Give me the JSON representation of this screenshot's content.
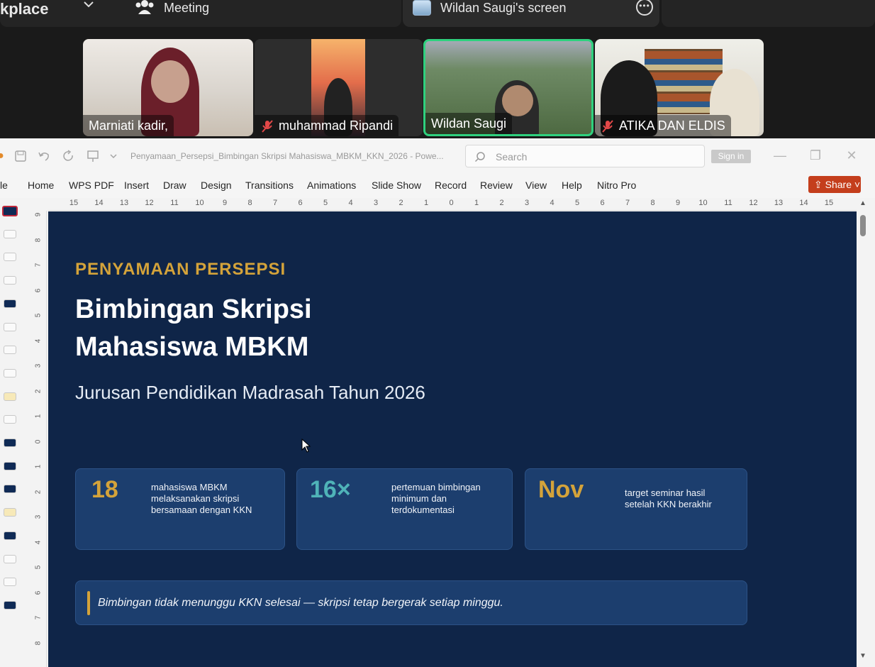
{
  "meeting": {
    "workplace_label": "kplace",
    "meeting_tab": "Meeting",
    "screen_tab": "Wildan Saugi's screen",
    "more_label": "•••"
  },
  "participants": [
    {
      "name": "Marniati kadir,",
      "muted": false
    },
    {
      "name": "muhammad Ripandi",
      "muted": true
    },
    {
      "name": "Wildan Saugi",
      "muted": false,
      "active_speaker": true
    },
    {
      "name": "ATIKA DAN ELDIS",
      "muted": true
    }
  ],
  "ppt": {
    "doc_title": "Penyamaan_Persepsi_Bimbingan Skripsi Mahasiswa_MBKM_KKN_2026 - Powe...",
    "search_placeholder": "Search",
    "signin": "Sign in",
    "file_tab_partial": "le",
    "tabs": [
      "Home",
      "WPS PDF",
      "Insert",
      "Draw",
      "Design",
      "Transitions",
      "Animations",
      "Slide Show",
      "Record",
      "Review",
      "View",
      "Help",
      "Nitro Pro"
    ],
    "share": "Share",
    "ruler_h": [
      "15",
      "14",
      "13",
      "12",
      "11",
      "10",
      "9",
      "8",
      "7",
      "6",
      "5",
      "4",
      "3",
      "2",
      "1",
      "0",
      "1",
      "2",
      "3",
      "4",
      "5",
      "6",
      "7",
      "8",
      "9",
      "10",
      "11",
      "12",
      "13",
      "14",
      "15"
    ],
    "ruler_v": [
      "9",
      "8",
      "7",
      "6",
      "5",
      "4",
      "3",
      "2",
      "1",
      "0",
      "1",
      "2",
      "3",
      "4",
      "5",
      "6",
      "7",
      "8"
    ]
  },
  "slide": {
    "kicker": "PENYAMAAN PERSEPSI",
    "title_line1": "Bimbingan Skripsi",
    "title_line2": "Mahasiswa MBKM",
    "subtitle": "Jurusan Pendidikan Madrasah Tahun 2026",
    "cards": [
      {
        "big": "18",
        "desc": "mahasiswa MBKM melaksanakan skripsi bersamaan dengan KKN",
        "big_color": "#d4a33a"
      },
      {
        "big": "16×",
        "desc": "pertemuan bimbingan minimum dan terdokumentasi",
        "big_color": "#4fb3b8"
      },
      {
        "big": "Nov",
        "desc": "target seminar hasil setelah KKN berakhir",
        "big_color": "#d4a33a"
      }
    ],
    "quote": "Bimbingan tidak menunggu KKN selesai — skripsi tetap bergerak setiap minggu."
  }
}
